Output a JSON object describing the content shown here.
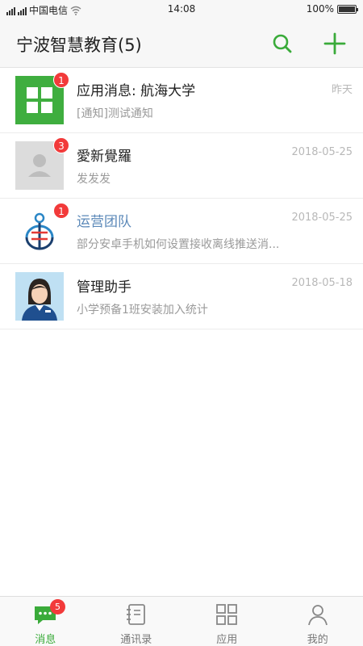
{
  "status_bar": {
    "carrier": "中国电信",
    "time": "14:08",
    "battery": "100%",
    "battery_level": 1.0
  },
  "header": {
    "title": "宁波智慧教育(5)",
    "search_icon": "search-icon",
    "add_icon": "plus-icon"
  },
  "conversations": [
    {
      "name": "应用消息: 航海大学",
      "time": "昨天",
      "preview": "[通知]测试通知",
      "badge": "1",
      "avatar": "app-grid-icon"
    },
    {
      "name": "愛新覺羅",
      "time": "2018-05-25",
      "preview": "发发发",
      "badge": "3",
      "avatar": "default-person-avatar"
    },
    {
      "name": "运营团队",
      "time": "2018-05-25",
      "preview": "部分安卓手机如何设置接收离线推送消...",
      "badge": "1",
      "avatar": "team-logo"
    },
    {
      "name": "管理助手",
      "time": "2018-05-18",
      "preview": "小学预备1班安装加入统计",
      "badge": "",
      "avatar": "assistant-avatar"
    }
  ],
  "tabs": [
    {
      "label": "消息",
      "icon": "chat-icon",
      "active": true,
      "badge": "5"
    },
    {
      "label": "通讯录",
      "icon": "contacts-book-icon",
      "active": false,
      "badge": ""
    },
    {
      "label": "应用",
      "icon": "apps-grid-icon",
      "active": false,
      "badge": ""
    },
    {
      "label": "我的",
      "icon": "person-icon",
      "active": false,
      "badge": ""
    }
  ],
  "colors": {
    "accent": "#3aab3a",
    "badge": "#f23a3a",
    "link_name": "#5b88b8"
  }
}
